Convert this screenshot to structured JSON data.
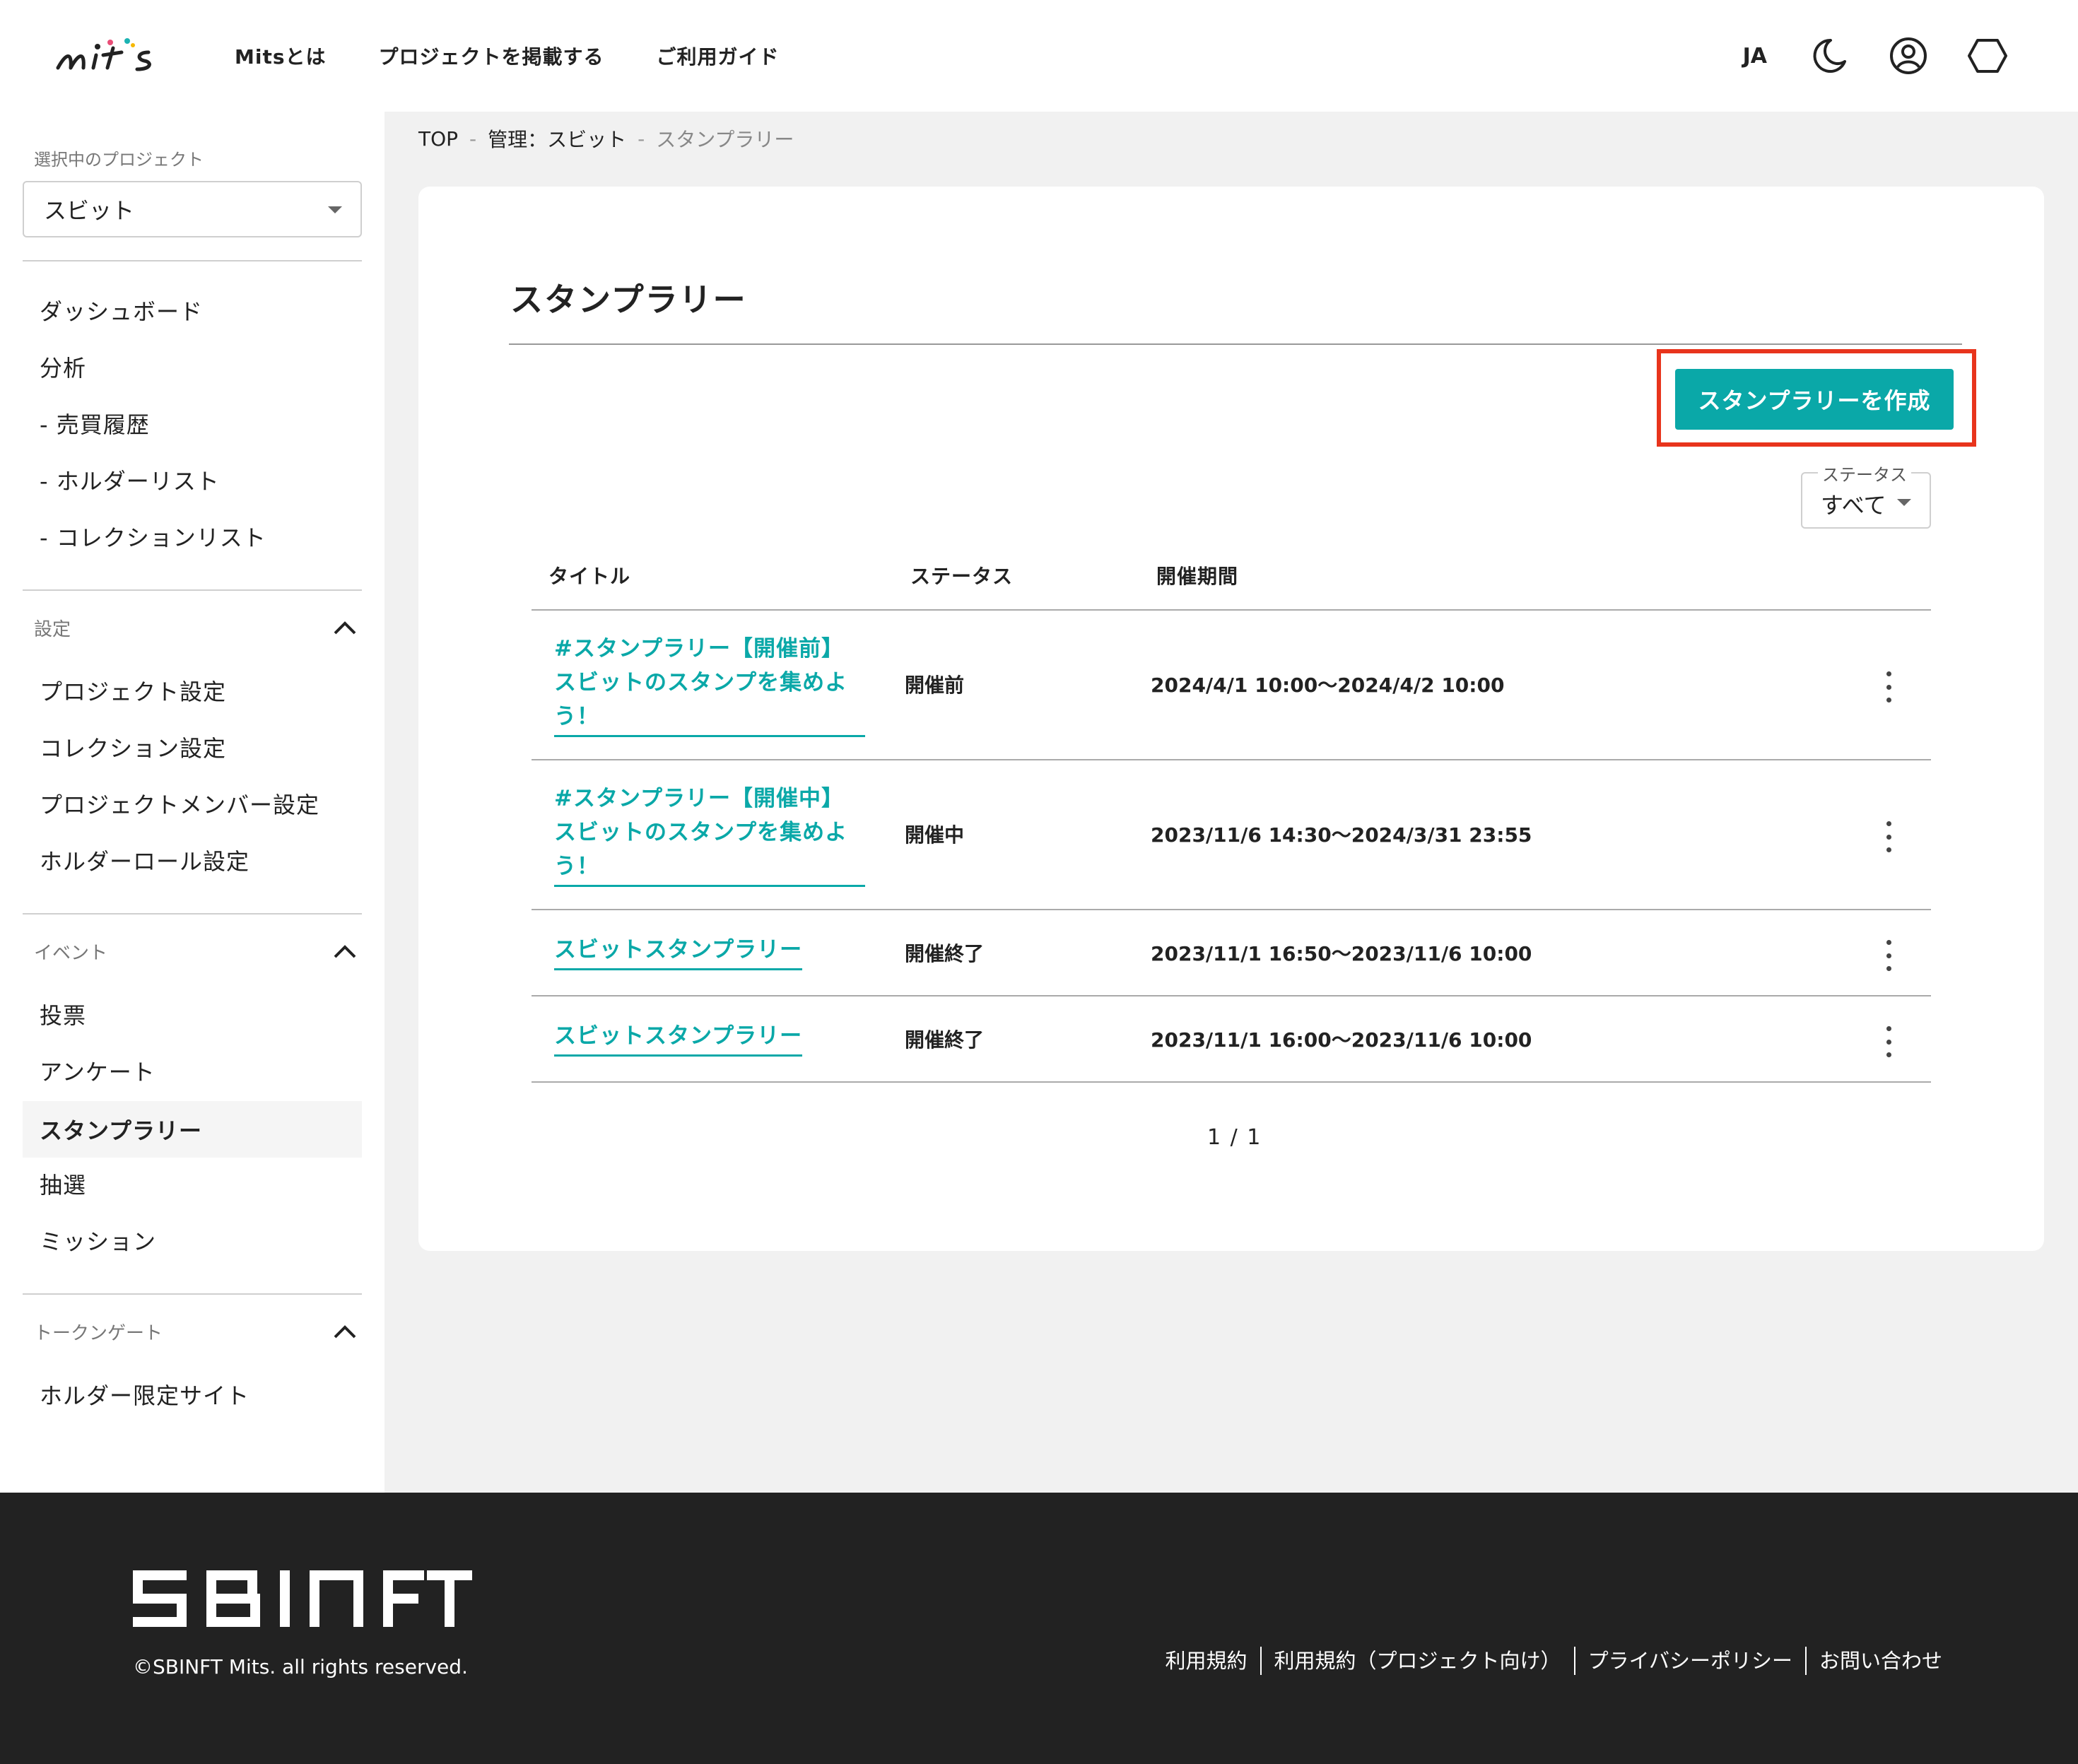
{
  "header": {
    "logo": "mits",
    "nav": [
      "Mitsとは",
      "プロジェクトを掲載する",
      "ご利用ガイド"
    ],
    "lang": "JA",
    "icons": [
      "moon-icon",
      "account-icon",
      "wallet-icon"
    ]
  },
  "sidebar": {
    "project_label": "選択中のプロジェクト",
    "project_value": "スビット",
    "main_items": [
      "ダッシュボード",
      "分析",
      "- 売買履歴",
      "- ホルダーリスト",
      "- コレクションリスト"
    ],
    "settings_title": "設定",
    "settings_items": [
      "プロジェクト設定",
      "コレクション設定",
      "プロジェクトメンバー設定",
      "ホルダーロール設定"
    ],
    "event_title": "イベント",
    "event_items": [
      "投票",
      "アンケート",
      "スタンプラリー",
      "抽選",
      "ミッション"
    ],
    "token_title": "トークンゲート",
    "token_items": [
      "ホルダー限定サイト"
    ]
  },
  "breadcrumb": [
    "TOP",
    "管理：スビット",
    "スタンプラリー"
  ],
  "main": {
    "title": "スタンプラリー",
    "create_button": "スタンプラリーを作成",
    "status_filter_label": "ステータス",
    "status_filter_value": "すべて",
    "columns": [
      "タイトル",
      "ステータス",
      "開催期間"
    ],
    "rows": [
      {
        "title": "#スタンプラリー【開催前】スビットのスタンプを集めよう！",
        "status": "開催前",
        "period": "2024/4/1 10:00〜2024/4/2 10:00"
      },
      {
        "title": "#スタンプラリー【開催中】スビットのスタンプを集めよう！",
        "status": "開催中",
        "period": "2023/11/6 14:30〜2024/3/31 23:55"
      },
      {
        "title": "スビットスタンプラリー",
        "status": "開催終了",
        "period": "2023/11/1 16:50〜2023/11/6 10:00"
      },
      {
        "title": "スビットスタンプラリー",
        "status": "開催終了",
        "period": "2023/11/1 16:00〜2023/11/6 10:00"
      }
    ],
    "pager": "1 / 1"
  },
  "footer": {
    "brand": "SBINFT",
    "copyright": "©SBINFT Mits. all rights reserved.",
    "links": [
      "利用規約",
      "利用規約（プロジェクト向け）",
      "プライバシーポリシー",
      "お問い合わせ"
    ]
  },
  "colors": {
    "accent": "#0aa8a8",
    "highlight": "#e8341c",
    "footer_bg": "#222222"
  }
}
